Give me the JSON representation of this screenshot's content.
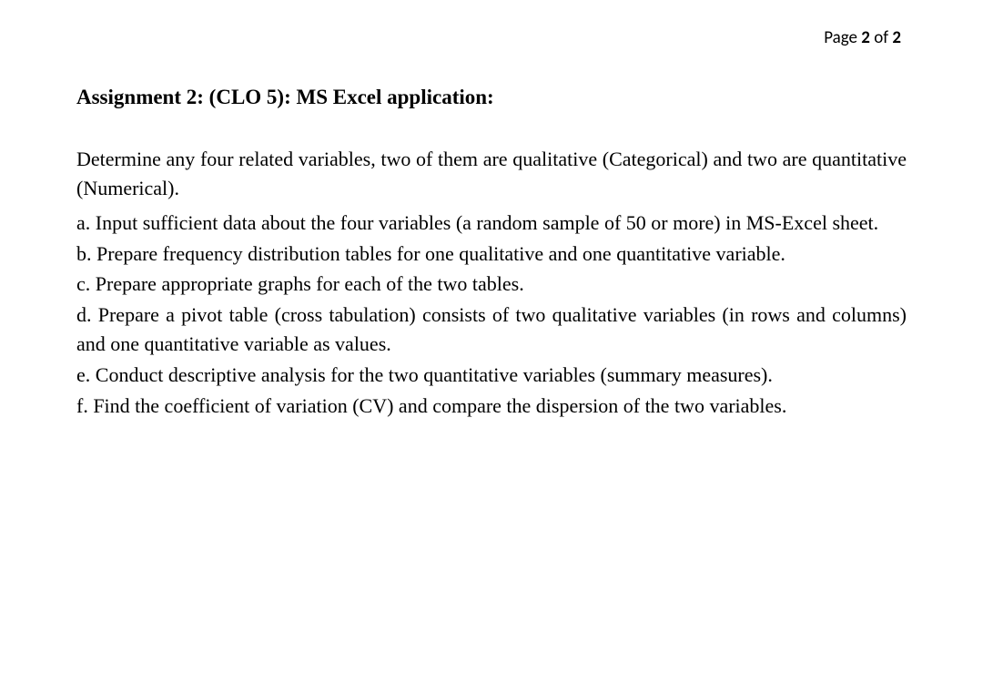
{
  "page": {
    "label_prefix": "Page ",
    "current": "2",
    "of_label": " of ",
    "total": "2"
  },
  "title": "Assignment 2: (CLO 5): MS Excel application:",
  "intro": "Determine any four related variables, two of them are qualitative (Categorical) and two are quantitative (Numerical).",
  "items": {
    "a": "a. Input sufficient data about the four variables (a random sample of 50 or more) in MS-Excel sheet.",
    "b": "b. Prepare frequency distribution tables for one qualitative and one quantitative variable.",
    "c": "c. Prepare appropriate graphs for each of the two tables.",
    "d": "d. Prepare a pivot table (cross tabulation) consists of two qualitative variables (in rows and columns) and one quantitative variable as values.",
    "e": "e. Conduct descriptive analysis for the two quantitative variables (summary measures).",
    "f": "f. Find the coefficient of variation (CV) and compare the dispersion of the two variables."
  }
}
